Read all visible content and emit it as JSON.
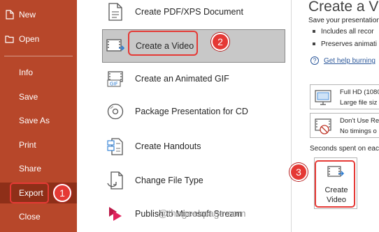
{
  "nav": {
    "new": "New",
    "open": "Open",
    "info": "Info",
    "save": "Save",
    "save_as": "Save As",
    "print": "Print",
    "share": "Share",
    "export": "Export",
    "close": "Close"
  },
  "export_options": [
    {
      "label": "Create PDF/XPS Document",
      "icon": "pdf-document-icon"
    },
    {
      "label": "Create a Video",
      "icon": "video-icon"
    },
    {
      "label": "Create an Animated GIF",
      "icon": "gif-icon"
    },
    {
      "label": "Package Presentation for CD",
      "icon": "cd-icon"
    },
    {
      "label": "Create Handouts",
      "icon": "handouts-icon"
    },
    {
      "label": "Change File Type",
      "icon": "file-type-icon"
    },
    {
      "label": "Publish to Microsoft Stream",
      "icon": "stream-icon"
    }
  ],
  "details": {
    "title": "Create a Vid",
    "intro": "Save your presentation",
    "bullet_1": "Includes all recor",
    "bullet_2": "Preserves animati",
    "help_link": "Get help burning",
    "quality": {
      "line1": "Full HD (1080",
      "line2": "Large file siz"
    },
    "timings": {
      "line1": "Don't Use Re",
      "line2": "No timings o"
    },
    "seconds_label": "Seconds spent on eac",
    "create_button": {
      "line1": "Create",
      "line2": "Video"
    }
  },
  "annotations": {
    "step1": "1",
    "step2": "2",
    "step3": "3"
  },
  "watermark": "@thegeekpage.com",
  "colors": {
    "nav_bg": "#b7472a",
    "nav_active": "#8e2f18",
    "callout": "#e53935",
    "link": "#2b579a",
    "selected_bg": "#c8c8c8"
  }
}
